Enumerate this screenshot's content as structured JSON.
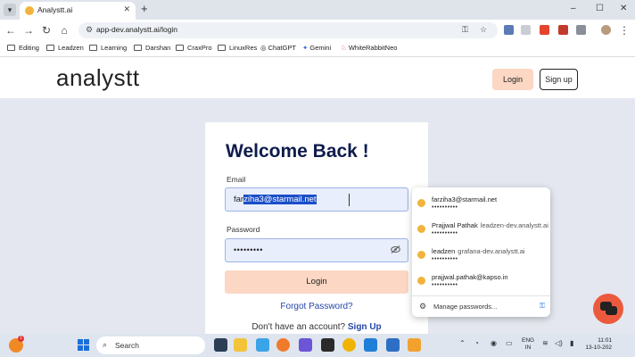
{
  "browser": {
    "tab_title": "Analystt.ai",
    "tab_close": "✕",
    "new_tab": "+",
    "window_controls": [
      "–",
      "☐",
      "✕"
    ],
    "url": "app-dev.analystt.ai/login",
    "nav": {
      "back": "←",
      "forward": "→",
      "reload": "↻",
      "home": "⌂"
    },
    "bookmarks": [
      "Editing",
      "Leadzen",
      "Learning",
      "Darshan",
      "CraxPro",
      "LinuxRes",
      "ChatGPT",
      "Gemini",
      "WhiteRabbitNeo"
    ]
  },
  "header": {
    "logo": "analystt",
    "login_label": "Login",
    "signup_label": "Sign up"
  },
  "login": {
    "title": "Welcome Back !",
    "email_label": "Email",
    "email_typed": "far",
    "email_selected": "ziha3@starmail.net",
    "password_label": "Password",
    "password_value": "•••••••••",
    "submit_label": "Login",
    "forgot_label": "Forgot Password?",
    "no_account_text": "Don't have an account?",
    "signup_link": "Sign Up"
  },
  "password_suggestions": {
    "items": [
      {
        "user": "farziha3@starmail.net",
        "site": "",
        "dots": "••••••••••"
      },
      {
        "user": "Prajjwal Pathak",
        "site": "leadzen-dev.analystt.ai",
        "dots": "••••••••••"
      },
      {
        "user": "leadzen",
        "site": "grafana-dev.analystt.ai",
        "dots": "••••••••••"
      },
      {
        "user": "prajjwal.pathak@kapso.in",
        "site": "",
        "dots": "••••••••••"
      }
    ],
    "manage_label": "Manage passwords..."
  },
  "taskbar": {
    "search_label": "Search",
    "weather_badge": "1",
    "lang_line1": "ENG",
    "lang_line2": "IN",
    "time": "11:01",
    "date": "13-10-202"
  },
  "icons": {
    "key": "key-icon",
    "eye_off": "eye-off-icon",
    "chat": "chat-icon"
  },
  "colors": {
    "accent_peach": "#fbd7c4",
    "title_navy": "#0f1b4d",
    "link_blue": "#2746a8",
    "chat_orange": "#ec5a3d",
    "selection_blue": "#1a4ec9"
  }
}
